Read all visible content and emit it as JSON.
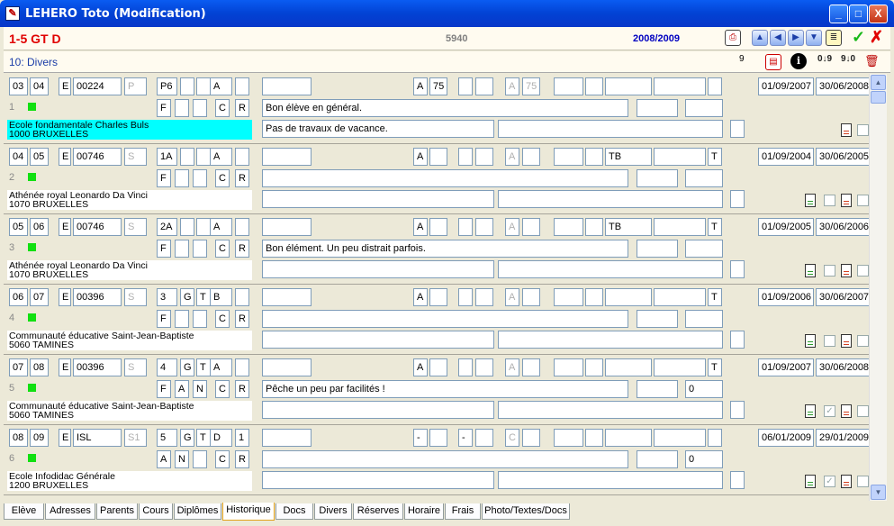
{
  "window": {
    "title": "LEHERO Toto (Modification)",
    "minimize": "_",
    "maximize": "□",
    "close": "X"
  },
  "header": {
    "class_code": "1-5 GT D",
    "number": "5940",
    "school_year": "2008/2009",
    "ok": "✓",
    "cancel": "✗"
  },
  "subheader": {
    "section": "10: Divers",
    "count": "9"
  },
  "records": [
    {
      "idx": "1",
      "c1": "03",
      "c2": "04",
      "c3": "E",
      "c4": "00224",
      "c5": "P",
      "c6": "P6",
      "c7": "",
      "c8": "",
      "c9": "A",
      "c10": "",
      "r2a": "F",
      "r2b": "",
      "r2c": "",
      "r2d": "C",
      "r2e": "R",
      "m1": "",
      "m2": "A",
      "m3": "75",
      "m4": "",
      "m5": "",
      "m6": "A",
      "m7": "75",
      "m8": "",
      "m9": "",
      "m10": "",
      "m11": "",
      "comment1": "Bon élève en général.",
      "comment2": "Pas de travaux de vacance.",
      "c3b": "",
      "date_start": "01/09/2007",
      "date_end": "30/06/2008",
      "school": "Ecole fondamentale  Charles Buls",
      "city": "1000 BRUXELLES",
      "hl": true,
      "g": false,
      "chk": ""
    },
    {
      "idx": "2",
      "c1": "04",
      "c2": "05",
      "c3": "E",
      "c4": "00746",
      "c5": "S",
      "c6": "1A",
      "c7": "",
      "c8": "",
      "c9": "A",
      "c10": "",
      "r2a": "F",
      "r2b": "",
      "r2c": "",
      "r2d": "C",
      "r2e": "R",
      "m1": "",
      "m2": "A",
      "m3": "",
      "m4": "",
      "m5": "",
      "m6": "A",
      "m7": "",
      "m8": "",
      "m9": "TB",
      "m10": "",
      "m11": "T",
      "comment1": "",
      "comment2": "",
      "c3b": "",
      "date_start": "01/09/2004",
      "date_end": "30/06/2005",
      "school": "Athénée royal Leonardo Da Vinci",
      "city": "1070 BRUXELLES",
      "hl": false,
      "g": true,
      "chk": ""
    },
    {
      "idx": "3",
      "c1": "05",
      "c2": "06",
      "c3": "E",
      "c4": "00746",
      "c5": "S",
      "c6": "2A",
      "c7": "",
      "c8": "",
      "c9": "A",
      "c10": "",
      "r2a": "F",
      "r2b": "",
      "r2c": "",
      "r2d": "C",
      "r2e": "R",
      "m1": "",
      "m2": "A",
      "m3": "",
      "m4": "",
      "m5": "",
      "m6": "A",
      "m7": "",
      "m8": "",
      "m9": "TB",
      "m10": "",
      "m11": "T",
      "comment1": "Bon élément. Un peu distrait parfois.",
      "comment2": "",
      "c3b": "",
      "date_start": "01/09/2005",
      "date_end": "30/06/2006",
      "school": "Athénée royal Leonardo Da Vinci",
      "city": "1070 BRUXELLES",
      "hl": false,
      "g": true,
      "chk": ""
    },
    {
      "idx": "4",
      "c1": "06",
      "c2": "07",
      "c3": "E",
      "c4": "00396",
      "c5": "S",
      "c6": "3",
      "c7": "G",
      "c8": "T",
      "c9": "B",
      "c10": "",
      "r2a": "F",
      "r2b": "",
      "r2c": "",
      "r2d": "C",
      "r2e": "R",
      "m1": "",
      "m2": "A",
      "m3": "",
      "m4": "",
      "m5": "",
      "m6": "A",
      "m7": "",
      "m8": "",
      "m9": "",
      "m10": "",
      "m11": "T",
      "comment1": "",
      "comment2": "",
      "c3b": "",
      "date_start": "01/09/2006",
      "date_end": "30/06/2007",
      "school": "Communauté éducative Saint-Jean-Baptiste",
      "city": "5060 TAMINES",
      "hl": false,
      "g": true,
      "chk": ""
    },
    {
      "idx": "5",
      "c1": "07",
      "c2": "08",
      "c3": "E",
      "c4": "00396",
      "c5": "S",
      "c6": "4",
      "c7": "G",
      "c8": "T",
      "c9": "A",
      "c10": "",
      "r2a": "F",
      "r2b": "A",
      "r2c": "N",
      "r2d": "C",
      "r2e": "R",
      "m1": "",
      "m2": "A",
      "m3": "",
      "m4": "",
      "m5": "",
      "m6": "A",
      "m7": "",
      "m8": "",
      "m9": "",
      "m10": "",
      "m11": "T",
      "comment1": "Pêche un peu par facilités !",
      "comment2": "",
      "c3b": "0",
      "date_start": "01/09/2007",
      "date_end": "30/06/2008",
      "school": "Communauté éducative Saint-Jean-Baptiste",
      "city": "5060 TAMINES",
      "hl": false,
      "g": true,
      "chk": "✓"
    },
    {
      "idx": "6",
      "c1": "08",
      "c2": "09",
      "c3": "E",
      "c4": "ISL",
      "c5": "S1",
      "c6": "5",
      "c7": "G",
      "c8": "T",
      "c9": "D",
      "c10": "1",
      "r2a": "A",
      "r2b": "N",
      "r2c": "",
      "r2d": "C",
      "r2e": "R",
      "m1": "",
      "m2": "-",
      "m3": "",
      "m4": "-",
      "m5": "",
      "m6": "C",
      "m7": "",
      "m8": "",
      "m9": "",
      "m10": "",
      "m11": "",
      "comment1": "",
      "comment2": "",
      "c3b": "0",
      "date_start": "06/01/2009",
      "date_end": "29/01/2009",
      "school": "Ecole Infodidac Générale",
      "city": "1200 BRUXELLES",
      "hl": false,
      "g": true,
      "chk": "✓"
    }
  ],
  "tabs": [
    "Elève",
    "Adresses",
    "Parents",
    "Cours",
    "Diplômes",
    "Historique",
    "Docs",
    "Divers",
    "Réserves",
    "Horaire",
    "Frais",
    "Photo/Textes/Docs"
  ],
  "active_tab": "Historique",
  "icons": [
    "printer-icon",
    "arrow-first-icon",
    "arrow-prev-icon",
    "arrow-next-icon",
    "arrow-last-icon",
    "notes-icon",
    "calendar-icon",
    "info-icon",
    "sort-asc-icon",
    "sort-desc-icon",
    "trash-icon"
  ],
  "colors": {
    "class_code": "#E00000",
    "school_year": "#0000C0",
    "highlight": "#00FFFF",
    "ok": "#18B818",
    "cancel": "#E00000"
  }
}
